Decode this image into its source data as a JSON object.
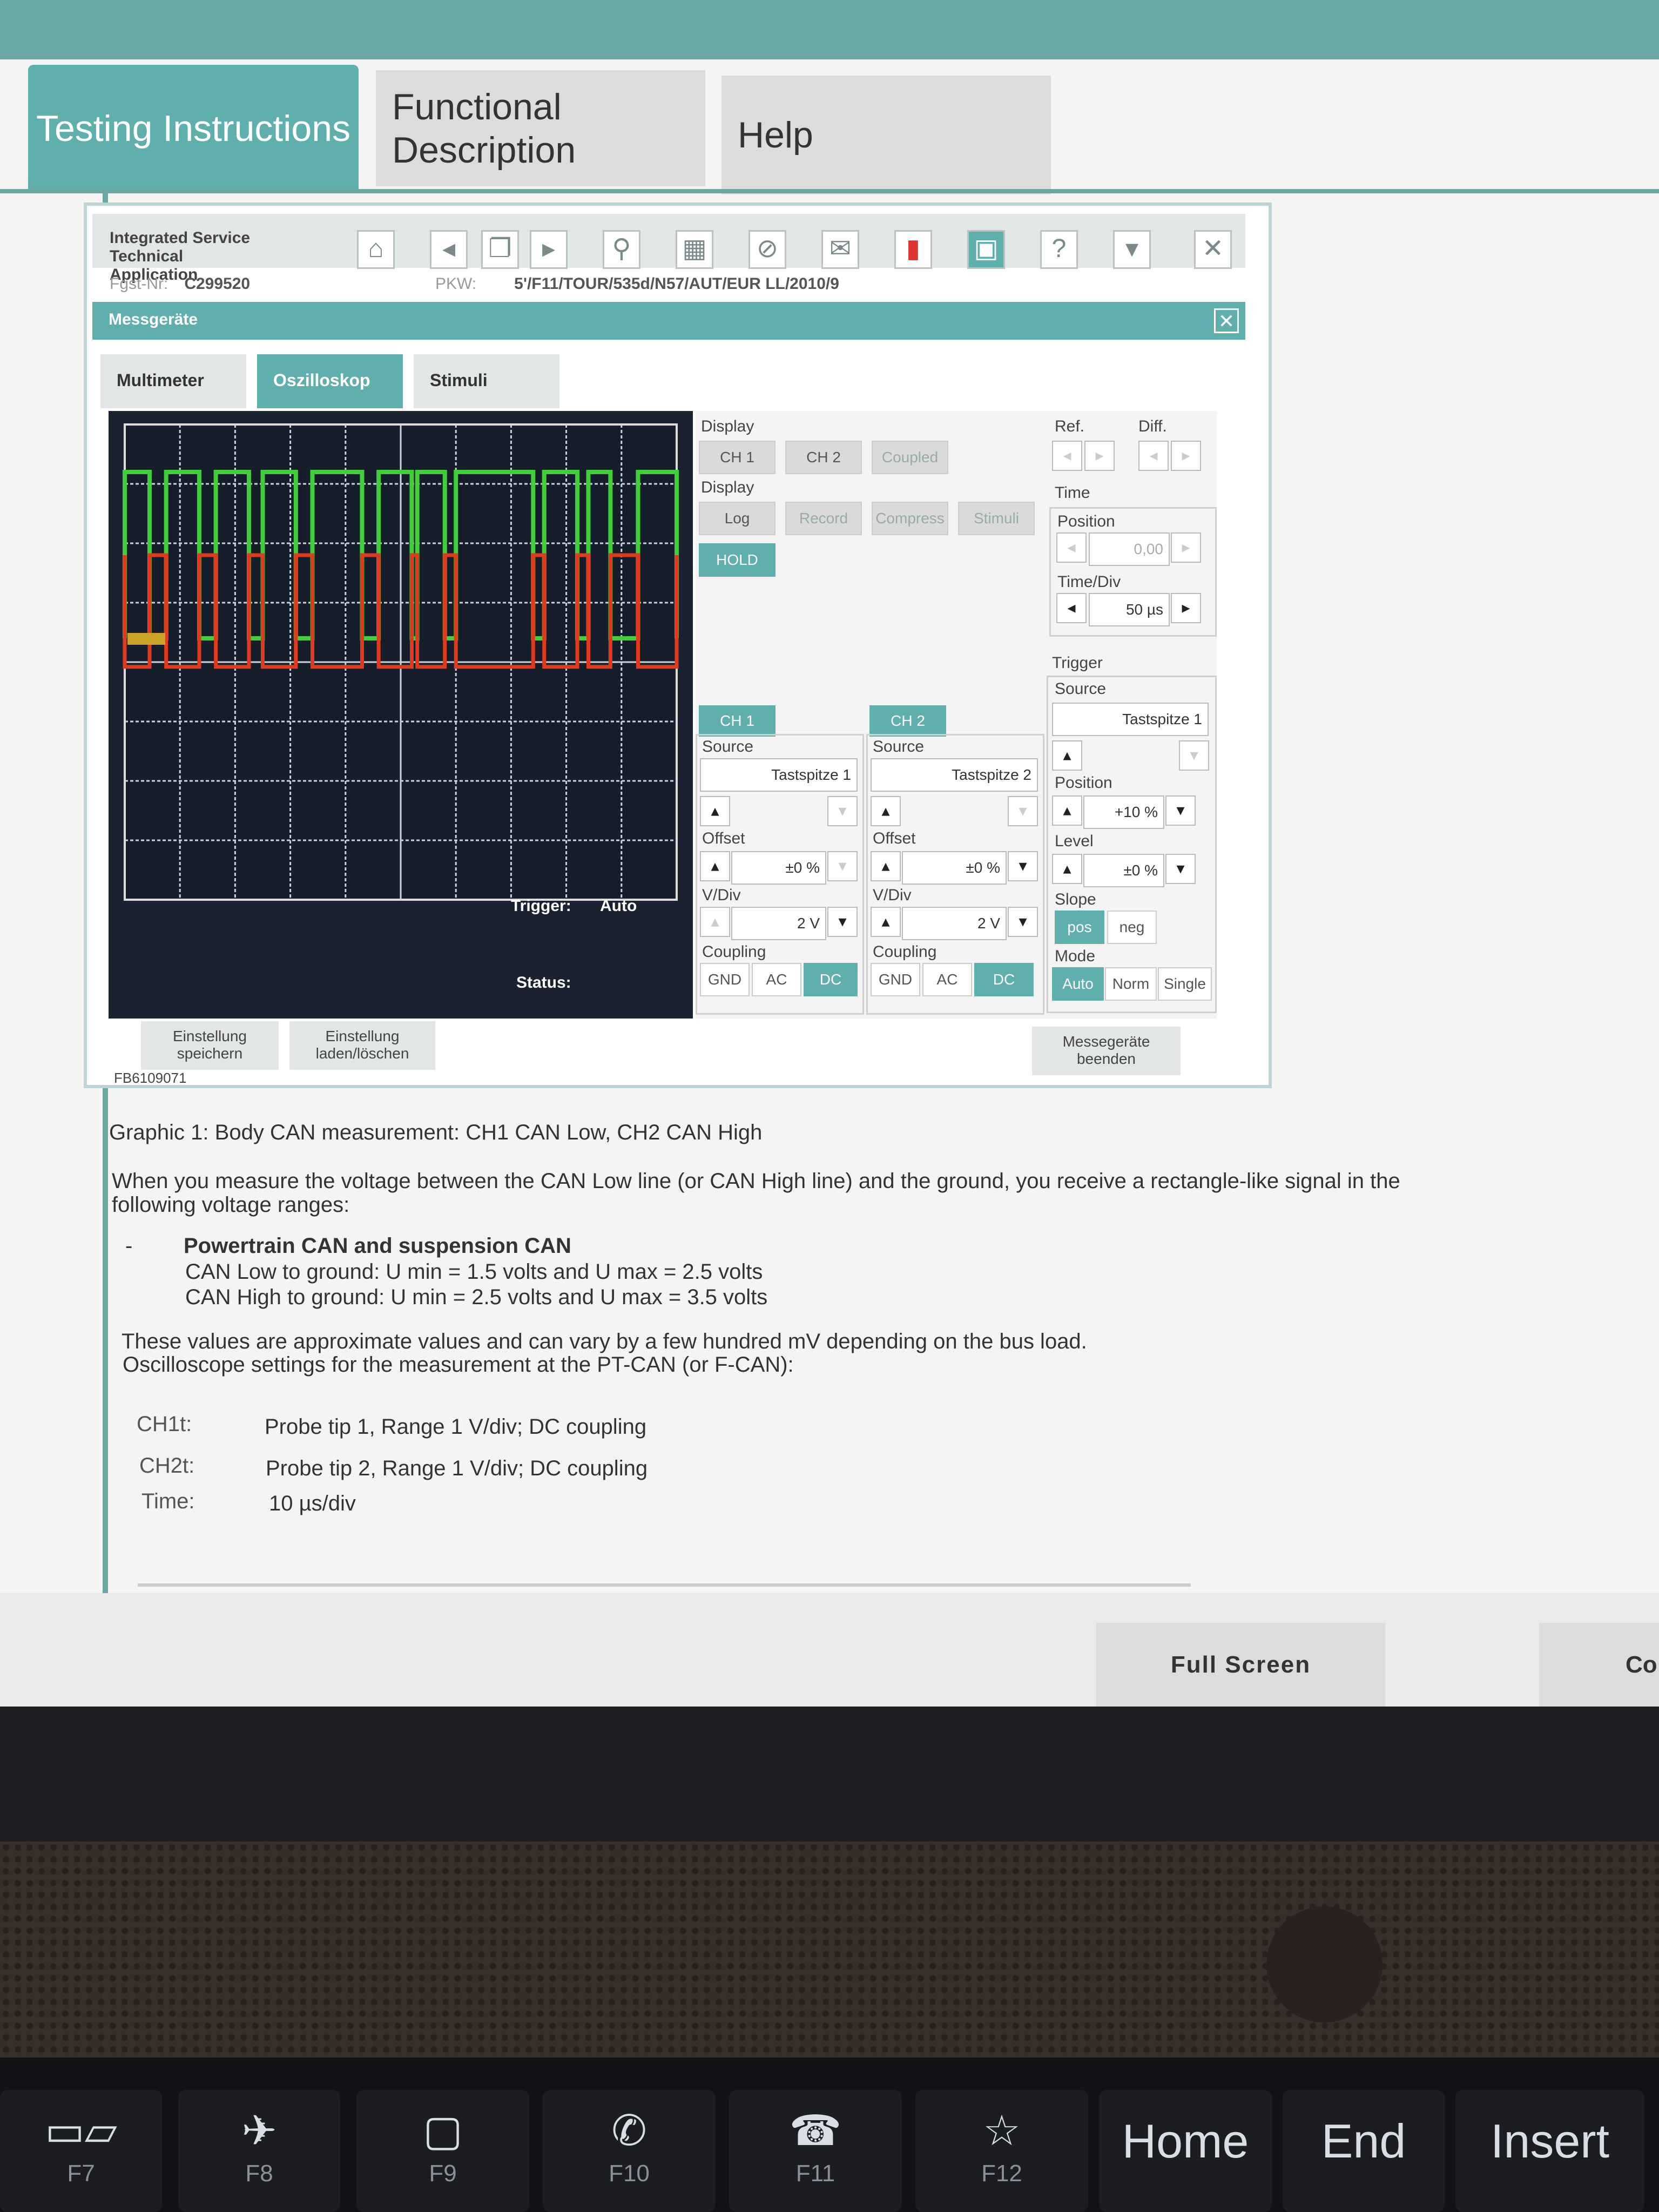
{
  "tabs": {
    "testing": "Testing Instructions",
    "functional": "Functional Description",
    "help": "Help"
  },
  "ista": {
    "title": "Integrated Service Technical Application",
    "fgst_label": "Fgst-Nr:",
    "fgst_value": "C299520",
    "pkw_label": "PKW:",
    "pkw_value": "5'/F11/TOUR/535d/N57/AUT/EUR LL/2010/9",
    "section": "Messgeräte",
    "subtabs": {
      "multimeter": "Multimeter",
      "oszilloskop": "Oszilloskop",
      "stimuli": "Stimuli"
    }
  },
  "scope": {
    "trigger_label": "Trigger:",
    "trigger_value": "Auto",
    "status_label": "Status:",
    "colors": {
      "ch1": "#e03a1e",
      "ch2": "#3fcf3a"
    },
    "signal": {
      "ch2_high": [
        [
          0,
          0.045
        ],
        [
          0.075,
          0.135
        ],
        [
          0.165,
          0.225
        ],
        [
          0.25,
          0.31
        ],
        [
          0.34,
          0.43
        ],
        [
          0.46,
          0.52
        ],
        [
          0.53,
          0.58
        ],
        [
          0.6,
          0.74
        ],
        [
          0.76,
          0.82
        ],
        [
          0.84,
          0.88
        ],
        [
          0.93,
          1.0
        ]
      ]
    }
  },
  "panel": {
    "display1": {
      "label": "Display",
      "ch1": "CH 1",
      "ch2": "CH 2",
      "coupled": "Coupled"
    },
    "display2": {
      "label": "Display",
      "log": "Log",
      "record": "Record",
      "compress": "Compress",
      "stimuli": "Stimuli"
    },
    "hold": "HOLD",
    "ref": "Ref.",
    "diff": "Diff.",
    "time": {
      "label": "Time",
      "position_label": "Position",
      "position_value": "0,00",
      "timediv_label": "Time/Div",
      "timediv_value": "50 µs"
    },
    "trigger": {
      "label": "Trigger",
      "source_label": "Source",
      "source_value": "Tastspitze 1",
      "position_label": "Position",
      "position_value": "+10 %",
      "level_label": "Level",
      "level_value": "±0 %",
      "slope_label": "Slope",
      "pos": "pos",
      "neg": "neg",
      "mode_label": "Mode",
      "auto": "Auto",
      "norm": "Norm",
      "single": "Single"
    },
    "ch1": {
      "head": "CH 1",
      "source_label": "Source",
      "source_value": "Tastspitze 1",
      "offset_label": "Offset",
      "offset_value": "±0 %",
      "vdiv_label": "V/Div",
      "vdiv_value": "2 V",
      "coupling_label": "Coupling",
      "gnd": "GND",
      "ac": "AC",
      "dc": "DC"
    },
    "ch2": {
      "head": "CH 2",
      "source_label": "Source",
      "source_value": "Tastspitze 2",
      "offset_label": "Offset",
      "offset_value": "±0 %",
      "vdiv_label": "V/Div",
      "vdiv_value": "2 V",
      "coupling_label": "Coupling",
      "gnd": "GND",
      "ac": "AC",
      "dc": "DC"
    }
  },
  "bottom_buttons": {
    "save": "Einstellung speichern",
    "load": "Einstellung laden/löschen",
    "end": "Messegeräte beenden"
  },
  "fb_number": "FB6109071",
  "doc": {
    "caption": "Graphic 1: Body CAN measurement: CH1 CAN Low, CH2 CAN High",
    "para1": "When you measure the voltage between the CAN Low line (or CAN High line) and the ground, you receive a rectangle-like signal in the following voltage ranges:",
    "bullet_dash": "-",
    "bullet_title": "Powertrain CAN and suspension CAN",
    "line_low": "CAN Low to ground: U min = 1.5 volts and U max = 2.5 volts",
    "line_high": "CAN High to ground: U min = 2.5 volts and U max = 3.5 volts",
    "para2": "These values are approximate values and can vary by a few hundred mV depending on the bus load.",
    "para3": "Oscilloscope settings for the measurement at the PT-CAN (or F-CAN):",
    "settings": [
      {
        "key": "CH1t:",
        "value": "Probe tip 1, Range 1 V/div; DC coupling"
      },
      {
        "key": "CH2t:",
        "value": "Probe tip 2, Range 1 V/div; DC coupling"
      },
      {
        "key": "Time:",
        "value": "10 µs/div"
      }
    ]
  },
  "footer": {
    "fullscreen": "Full Screen",
    "co": "Co"
  },
  "keyboard": {
    "f7": "F7",
    "f8": "F8",
    "f9": "F9",
    "f10": "F10",
    "f11": "F11",
    "f12": "F12",
    "home": "Home",
    "end": "End",
    "insert": "Insert"
  }
}
